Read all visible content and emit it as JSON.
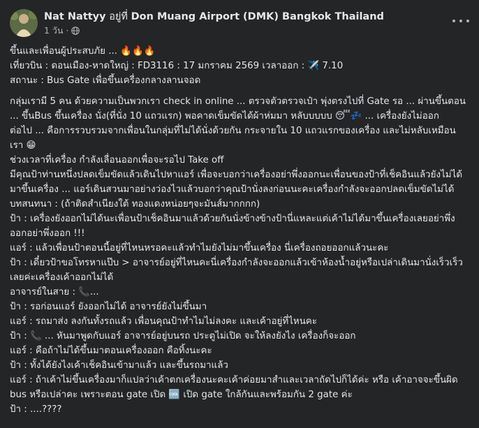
{
  "header": {
    "author": "Nat Nattyy",
    "at_text": "อยู่ที่",
    "place": "Don Muang Airport (DMK) Bangkok Thailand",
    "time": "1 วัน",
    "dot": "·"
  },
  "post": {
    "intro": [
      "ขึ้นและเพื่อนผู้ประสบภัย ... 🔥🔥🔥",
      "เที่ยวบิน : ดอนเมือง-หาดใหญ่ : FD3116 : 17 มกราคม 2569 เวลาออก : ✈️ 7.10",
      "สถานะ : Bus Gate เพื่อขึ้นเครื่องกลางลานจอด"
    ],
    "lines": [
      "กลุ่มเรามี 5 คน ด้วยความเป็นพวกเรา check in online ... ตรวจตัวตรวจเป๋า พุ่งตรงไปที่ Gate รอ ... ผ่านขึ้นตอน ... ขึ้นBus ขึ้นเครื่อง นั่ง(ที่นั่ง 10 แถวแรก)  พอคาดเข็มขัดได้ผ้าห่มมา หลับบบบบ 😴💤 ... เครื่องยังไม่ออก",
      "ต่อไป ... คือการรวบรวมจากเพื่อนในกลุ่มที่ไม่ได้นั่งด้วยกัน กระจายใน 10 แถวแรกของเครื่อง และไม่หลับเหมือนเรา 😁",
      "ช่วงเวลาที่เครื่อง กำลังเลื่อนออกเพื่อจะรอไป Take off",
      "มีคุณป้าท่านหนึ่งปลดเข็มขัดแล้วเดินไปหาแอร์ เพื่อจะบอกว่าเครื่องอย่าพึ่งออกนะเพื่อนของป้าที่เช็คอินแล้วยังไม่ได้มาขึ้นเครื่อง ... แอร์เดินสวนมาอย่างว่องไวแล้วบอกว่าคุณป้านั่งลงก่อนนะคะเครื่องกำลังจะออกปลดเข็มขัดไม่ได้",
      "บทสนทนา : (ถ้าติดสำเนียงใต้ ทองแดงหน่อยๆจะมันส์มากกกก)",
      "ป้า : เครื่องยังออกไม่ได้นะเพื่อนป้าเช็คอินมาแล้วด้วยกันนั่งข้างข้างป้านี่แหละแต่เค้าไม่ได้มาขึ้นเครื่องเลยอย่าพึ่งออกอย่าพึ่งออก !!!",
      "แอร์ : แล้วเพื่อนป้าตอนนี้อยู่ที่ไหนหรอคะแล้วทำไมยังไม่มาขึ้นเครื่อง นี่เครื่องถอยออกแล้วนะคะ",
      "ป้า : เดี๋ยวป้าขอโทรหาแป๊บ > อาจารย์อยู่ที่ไหนคะนี่เครื่องกำลังจะออกแล้วเข้าห้องน้ำอยู่หรือเปล่าเดินมานั่งเร็วเร็วเลยค่ะเครื่องเค้าออกไม่ได้",
      "อาจารย์ในสาย : 📞...",
      "ป้า : รอก่อนแอร์ ยังออกไม่ได้ อาจารย์ยังไม่ขึ้นมา",
      "แอร์ : รถมาส่ง ลงกันทั้งรถแล้ว เพื่อนคุณป้าทำไมไม่ลงคะ และเค้าอยู่ที่ไหนคะ",
      "ป้า : 📞 ... หันมาพูดกับแอร์ อาจารย์อยู่บนรถ ประตูไม่เปิด จะให้ลงยังไง เครื่องก็จะออก",
      "แอร์ : คือถ้าไม่ได้ขึ้นมาตอนเครื่องออก คือทิ้งนะคะ",
      "ป้า : ทั้งได้ยังไงเค้าเช็คอินเข้ามาแล้ว และขึ้นรถมาแล้ว",
      "แอร์ : ถ้าเค้าไม่ขึ้นเครื่องมาก็แปลว่าเค้าตกเครื่องนะคะเค้าค่อยมาสำและเวลาถัดไปก็ได้ค่ะ หรือ เค้าอาจจะขึ้นผิด bus หรือเปล่าคะ เพราะตอน gate เปิด 🆒 เปิด gate ใกล้กันและพร้อมกัน 2 gate ค่ะ",
      "ป้า : ....????"
    ]
  },
  "colors": {
    "background": "#242526",
    "text": "#e4e6eb",
    "secondary_text": "#b0b3b8"
  },
  "icons": {
    "audience": "globe-icon",
    "menu": "more-horizontal-icon"
  }
}
